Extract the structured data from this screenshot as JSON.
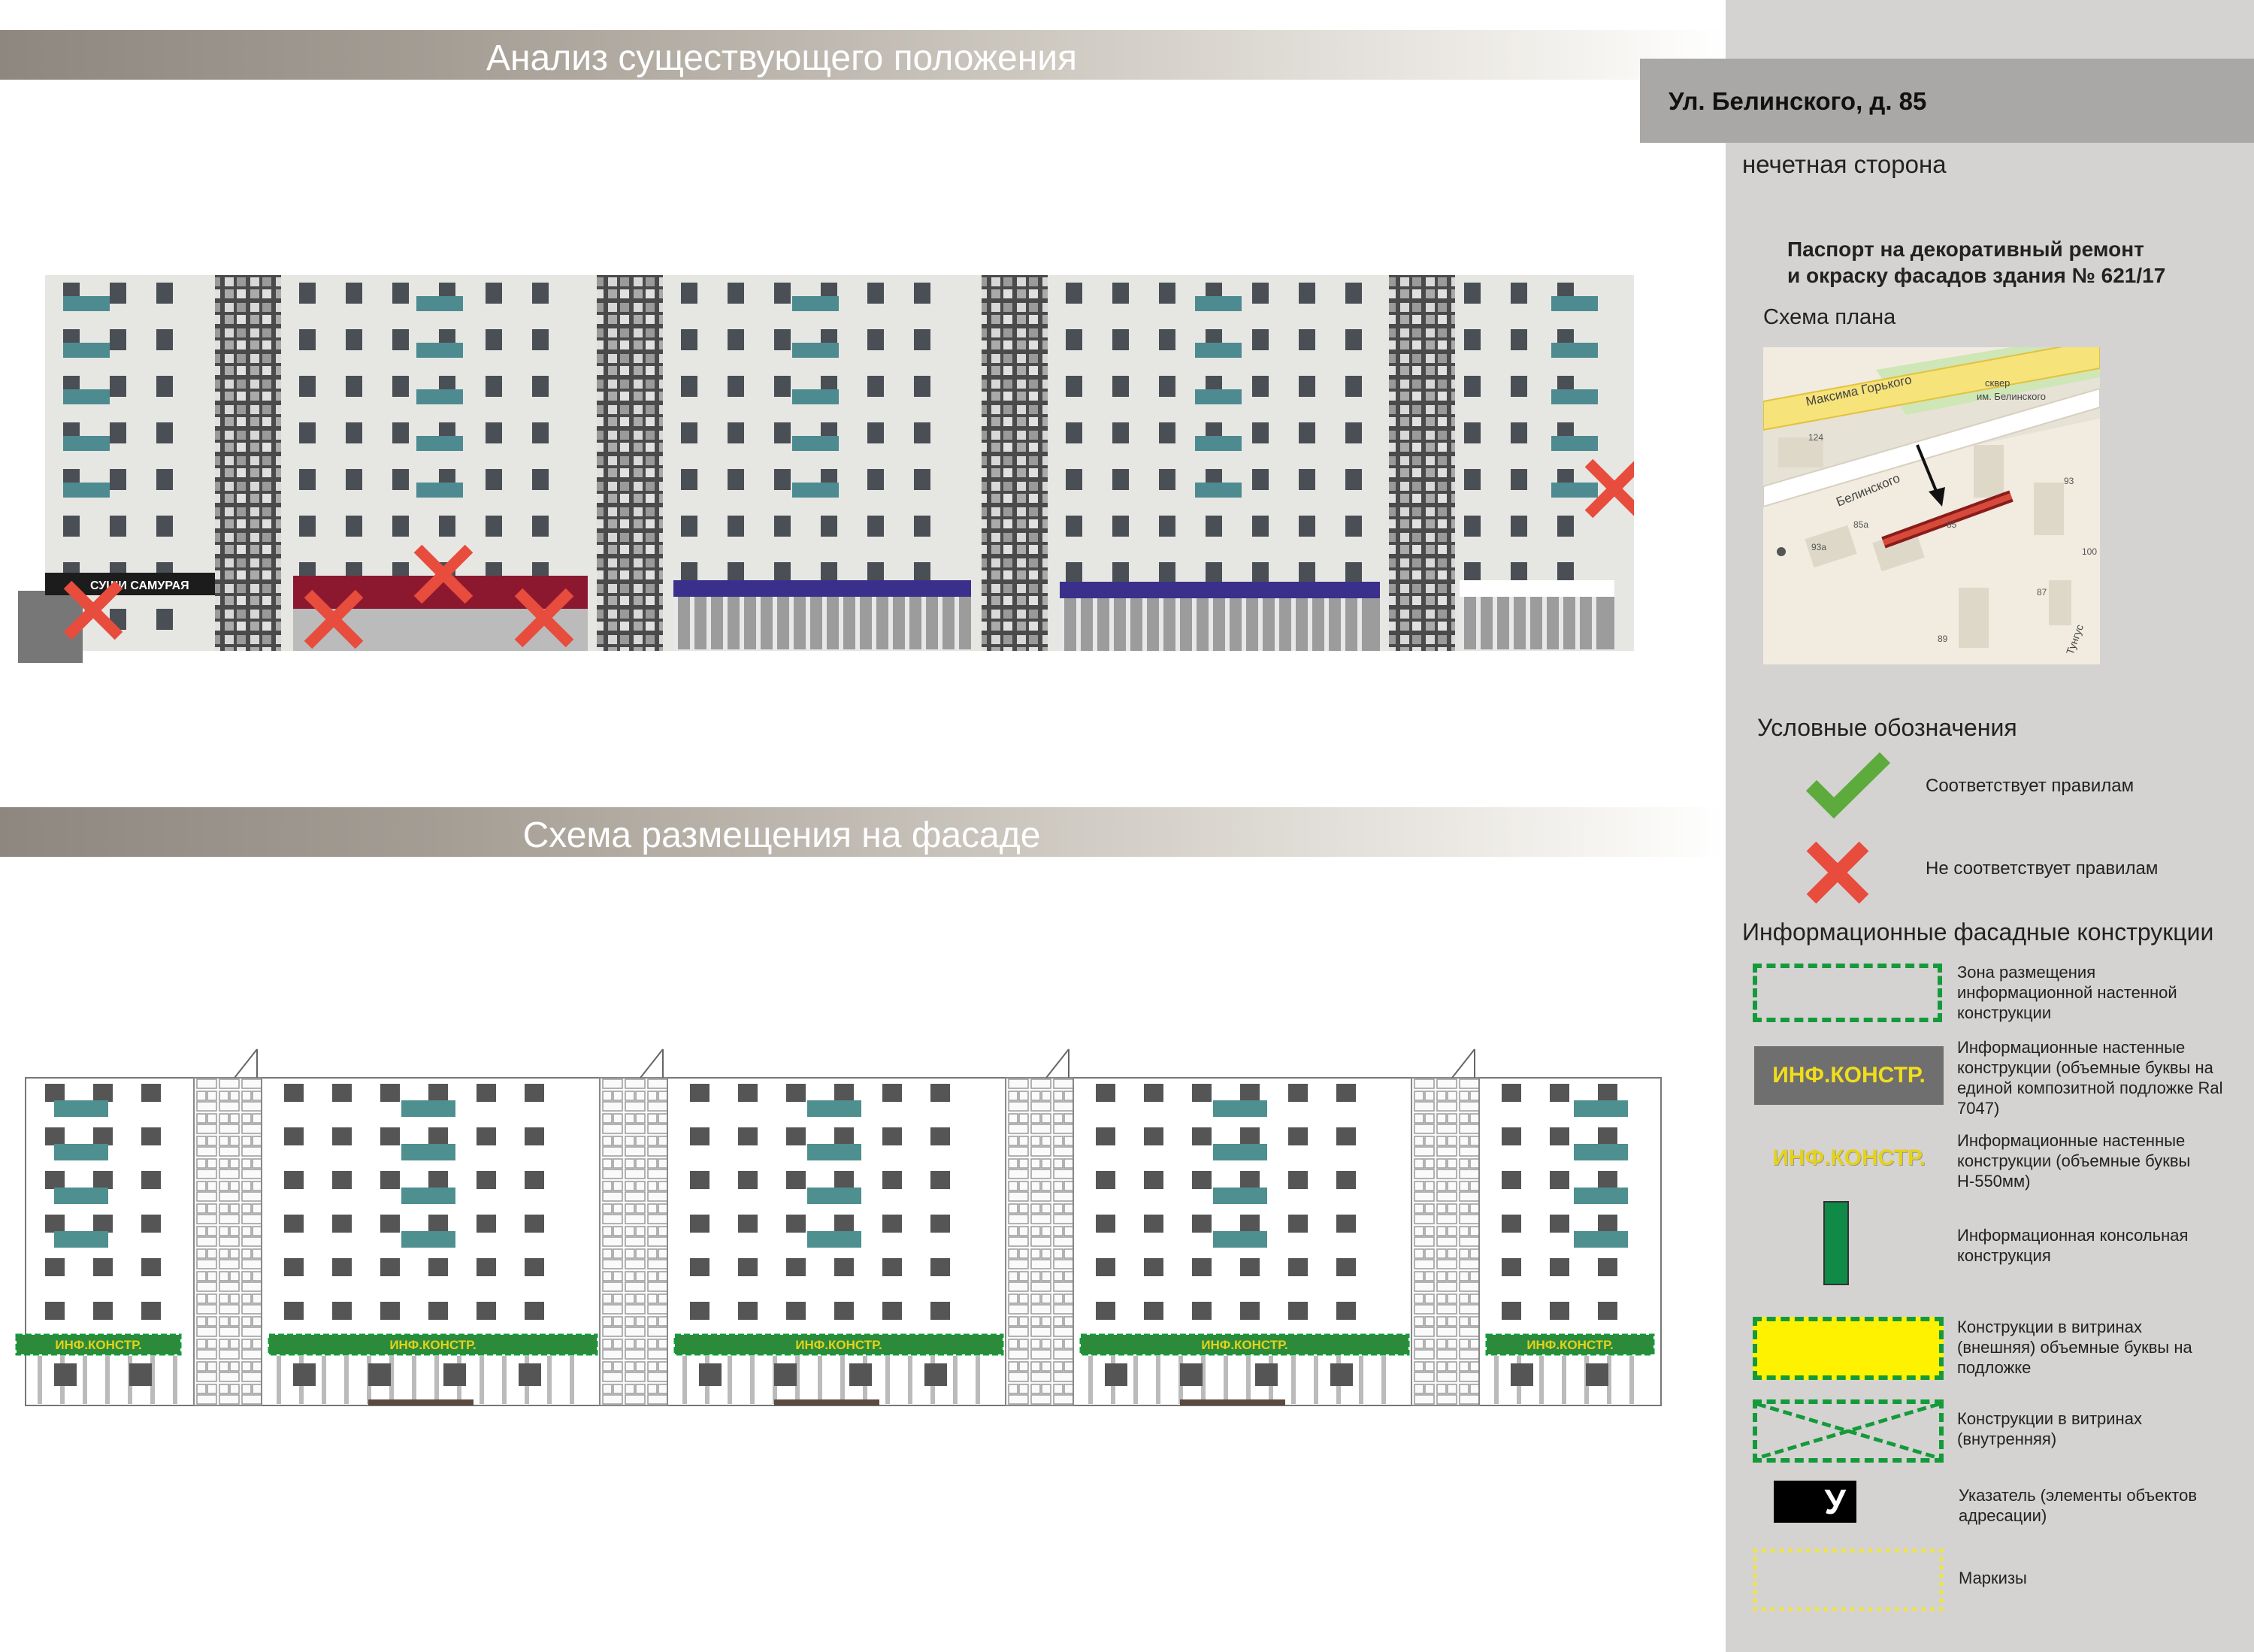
{
  "headers": {
    "analysis": "Анализ существующего положения",
    "scheme": "Схема размещения на фасаде"
  },
  "sidebar": {
    "address": "Ул. Белинского, д. 85",
    "side": "нечетная сторона",
    "passport": "Паспорт на декоративный ремонт",
    "passport_line2": "и окраску фасадов здания № 621/17",
    "plan_title": "Схема плана",
    "legend_title": "Условные обозначения",
    "legend_ok": "Соответствует правилам",
    "legend_bad": "Не соответствует правилам",
    "info_title": "Информационные фасадные конструкции"
  },
  "map": {
    "street1": "Максима Горького",
    "street2": "Белинского",
    "square": "сквер",
    "square2": "им. Белинского",
    "n124": "124",
    "n93": "93",
    "n85a": "85а",
    "n85": "85",
    "n93a": "93а",
    "n100": "100",
    "n87": "87",
    "n89": "89",
    "tung": "Тунгус"
  },
  "photo": {
    "sign_text": "СУШИ САМУРАЯ"
  },
  "facade": {
    "sign_label": "ИНФ.КОНСТР."
  },
  "legend": [
    {
      "key": "zone",
      "text": "Зона размещения информационной настенной конструкции"
    },
    {
      "key": "substrate",
      "text": "Информационные настенные конструкции (объемные буквы на единой композитной подложке Ral 7047)",
      "sample": "ИНФ.КОНСТР."
    },
    {
      "key": "letters",
      "text": "Информационные настенные конструкции (объемные буквы Н-550мм)",
      "sample": "ИНФ.КОНСТР."
    },
    {
      "key": "console",
      "text": "Информационная консольная конструкция"
    },
    {
      "key": "vitrine-ext",
      "text": "Конструкции в витринах (внешняя) объемные буквы на подложке"
    },
    {
      "key": "vitrine-int",
      "text": "Конструкции в витринах (внутренняя)"
    },
    {
      "key": "pointer",
      "text": "Указатель (элементы объектов адресации)",
      "sample": "У"
    },
    {
      "key": "awning",
      "text": "Маркизы"
    }
  ],
  "colors": {
    "balcony": "#4e8f8f",
    "zone_green": "#149a3a",
    "substrate_gray": "#6f6f6f",
    "letters_yellow": "#e5d21a",
    "console_green": "#0f8a47",
    "vitrine_yellow": "#fff200",
    "cross_red": "#e74c3c",
    "check_green": "#5cab3c",
    "awning_yellow": "#efe34a"
  }
}
